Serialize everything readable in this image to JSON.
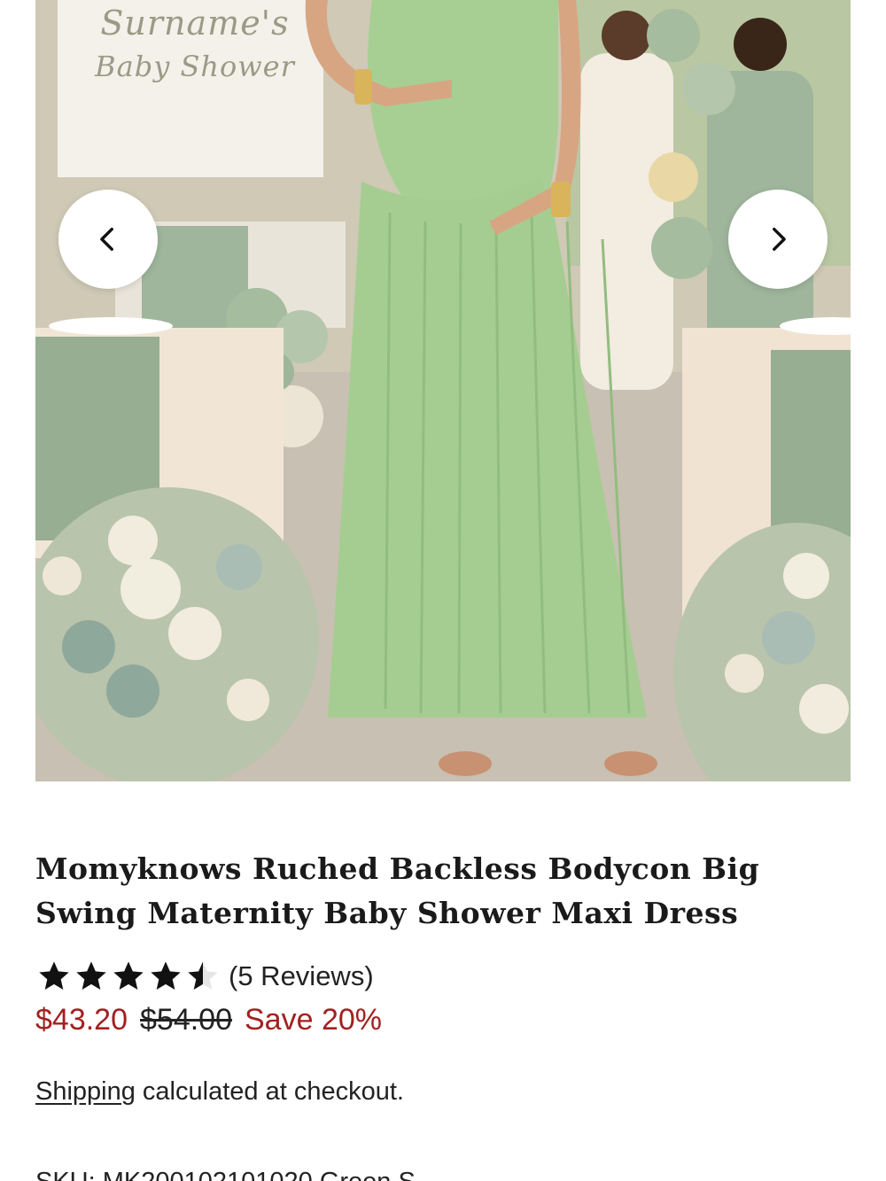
{
  "gallery": {
    "sign_line1": "Surname's",
    "sign_line2": "Baby Shower",
    "prev_icon": "chevron-left-icon",
    "next_icon": "chevron-right-icon"
  },
  "product": {
    "title": "Momyknows Ruched Backless Bodycon Big Swing Maternity Baby Shower Maxi Dress",
    "rating": 4.5,
    "rating_max": 5,
    "reviews_label": "(5 Reviews)",
    "price": "$43.20",
    "compare_price": "$54.00",
    "save_label": "Save 20%",
    "shipping_link": "Shipping",
    "shipping_text": " calculated at checkout.",
    "sku_text": "SKU: MK200102101020 Green S"
  },
  "colors": {
    "sale_red": "#a32020",
    "dress_green": "#a7cf93",
    "text_dark": "#1a1a1a"
  }
}
